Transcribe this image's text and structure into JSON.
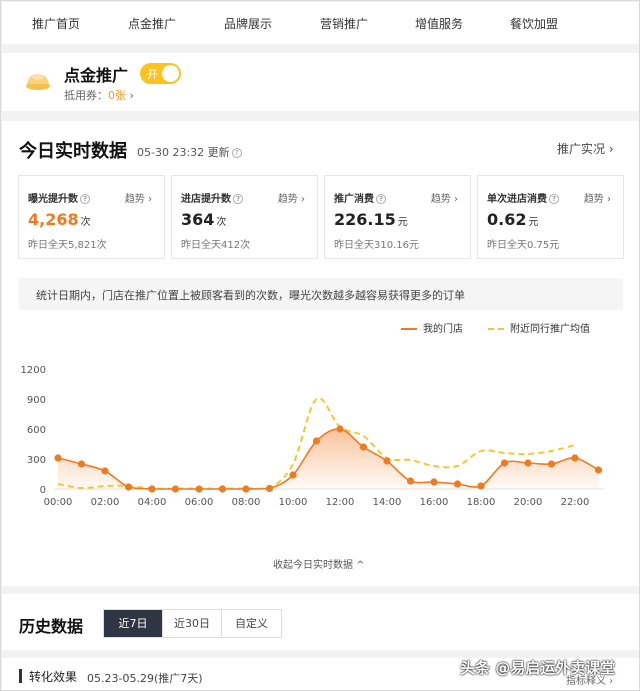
{
  "nav": {
    "items": [
      "推广首页",
      "点金推广",
      "品牌展示",
      "营销推广",
      "增值服务",
      "餐饮加盟"
    ]
  },
  "promo": {
    "title": "点金推广",
    "toggle_label": "开",
    "voucher_label": "抵用券：",
    "voucher_count": "0张",
    "voucher_arrow": "›"
  },
  "realtime": {
    "title": "今日实时数据",
    "update_time": "05-30 23:32 更新",
    "link": "推广实况 ›",
    "metrics": [
      {
        "label": "曝光提升数",
        "trend": "趋势 ›",
        "value": "4,268",
        "unit": "次",
        "yesterday": "昨日全天5,821次"
      },
      {
        "label": "进店提升数",
        "trend": "趋势 ›",
        "value": "364",
        "unit": "次",
        "yesterday": "昨日全天412次"
      },
      {
        "label": "推广消费",
        "trend": "趋势 ›",
        "value": "226.15",
        "unit": "元",
        "yesterday": "昨日全天310.16元"
      },
      {
        "label": "单次进店消费",
        "trend": "趋势 ›",
        "value": "0.62",
        "unit": "元",
        "yesterday": "昨日全天0.75元"
      }
    ],
    "description": "统计日期内，门店在推广位置上被顾客看到的次数，曝光次数越多越容易获得更多的订单",
    "collapse": "收起今日实时数据 ^"
  },
  "chart_data": {
    "type": "line",
    "x": [
      "00:00",
      "01:00",
      "02:00",
      "03:00",
      "04:00",
      "05:00",
      "06:00",
      "07:00",
      "08:00",
      "09:00",
      "10:00",
      "11:00",
      "12:00",
      "13:00",
      "14:00",
      "15:00",
      "16:00",
      "17:00",
      "18:00",
      "19:00",
      "20:00",
      "21:00",
      "22:00",
      "23:00"
    ],
    "x_ticks": [
      "00:00",
      "02:00",
      "04:00",
      "06:00",
      "08:00",
      "10:00",
      "12:00",
      "14:00",
      "16:00",
      "18:00",
      "20:00",
      "22:00"
    ],
    "y_ticks": [
      "0",
      "300",
      "600",
      "900",
      "1200"
    ],
    "ylim": [
      0,
      1200
    ],
    "series": [
      {
        "name": "我的门店",
        "color": "#f07a1f",
        "style": "solid-area",
        "values": [
          310,
          250,
          180,
          20,
          0,
          0,
          0,
          0,
          0,
          5,
          140,
          480,
          600,
          420,
          280,
          80,
          70,
          50,
          30,
          260,
          260,
          250,
          310,
          190
        ]
      },
      {
        "name": "附近同行推广均值",
        "color": "#f7c72c",
        "style": "dashed",
        "values": [
          50,
          10,
          30,
          30,
          5,
          5,
          5,
          5,
          5,
          10,
          250,
          900,
          620,
          530,
          310,
          290,
          230,
          230,
          380,
          360,
          350,
          380,
          440,
          0
        ]
      }
    ],
    "grid": false,
    "legend_position": "top-right"
  },
  "history": {
    "title": "历史数据",
    "tabs": [
      {
        "label": "近7日",
        "active": true
      },
      {
        "label": "近30日",
        "active": false
      },
      {
        "label": "自定义",
        "active": false
      }
    ]
  },
  "conversion": {
    "title": "转化效果",
    "range": "05.23-05.29(推广7天)",
    "metric_link": "指标释义 ›"
  },
  "watermark": "头条 @易启运外卖课堂"
}
